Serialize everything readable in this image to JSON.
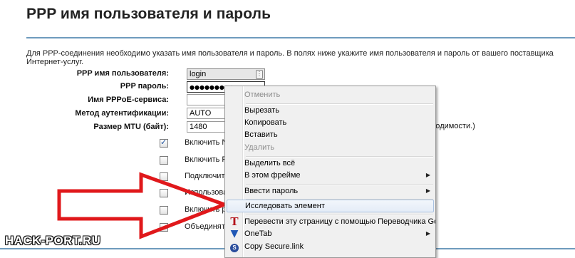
{
  "page": {
    "title": "PPP имя пользователя и пароль",
    "description": "Для PPP-соединения необходимо указать имя пользователя и пароль. В полях ниже укажите имя пользователя и пароль от вашего поставщика Интернет-услуг."
  },
  "form": {
    "username_label": "PPP имя пользователя:",
    "username_value": "login",
    "password_label": "PPP пароль:",
    "password_value": "●●●●●●●●●",
    "service_label": "Имя PPPoE-сервиса:",
    "service_value": "",
    "auth_label": "Метод аутентификации:",
    "auth_value": "AUTO",
    "mtu_label": "Размер MTU (байт):",
    "mtu_value": "1480",
    "mtu_note": "бходимости.)"
  },
  "checkboxes": [
    {
      "label": "Включить NA",
      "checked": true
    },
    {
      "label": "Включить Fu",
      "checked": false
    },
    {
      "label": "Подключить",
      "checked": false
    },
    {
      "label": "Использоват",
      "checked": false
    },
    {
      "label": "Включить ре",
      "checked": false
    },
    {
      "label": "Объединять",
      "checked": false
    }
  ],
  "context_menu": {
    "undo": "Отменить",
    "cut": "Вырезать",
    "copy": "Копировать",
    "paste": "Вставить",
    "delete": "Удалить",
    "select_all": "Выделить всё",
    "this_frame": "В этом фрейме",
    "enter_password": "Ввести пароль",
    "inspect": "Исследовать элемент",
    "translate": "Перевести эту страницу с помощью Переводчика Google",
    "onetab": "OneTab",
    "copy_secure_link": "Copy Secure.link"
  },
  "icons": {
    "translate": "translate-t-icon",
    "onetab": "onetab-funnel-icon",
    "secure_link": "secure-link-icon",
    "submenu": "submenu-arrow-icon"
  },
  "colors": {
    "rule": "#6e9bbd",
    "arrow": "#e0181b",
    "menu_highlight": "#a8c1e0"
  },
  "watermark": "HACK-PORT.RU"
}
